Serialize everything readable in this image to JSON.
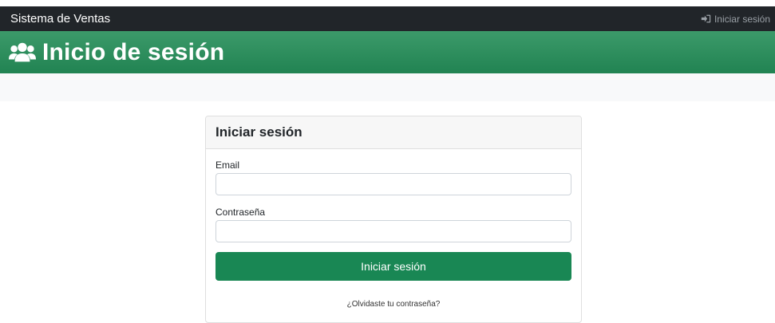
{
  "navbar": {
    "brand": "Sistema de Ventas",
    "login_link": "Iniciar sesión",
    "login_icon": "sign-in-icon"
  },
  "hero": {
    "icon": "users-icon",
    "title": "Inicio de sesión"
  },
  "login_card": {
    "title": "Iniciar sesión",
    "email_label": "Email",
    "email_value": "",
    "password_label": "Contraseña",
    "password_value": "",
    "submit_label": "Iniciar sesión",
    "forgot_link": "¿Olvidaste tu contraseña?"
  },
  "colors": {
    "navbar_bg": "#212529",
    "hero_bg": "#2e8b57",
    "button_bg": "#198754"
  }
}
